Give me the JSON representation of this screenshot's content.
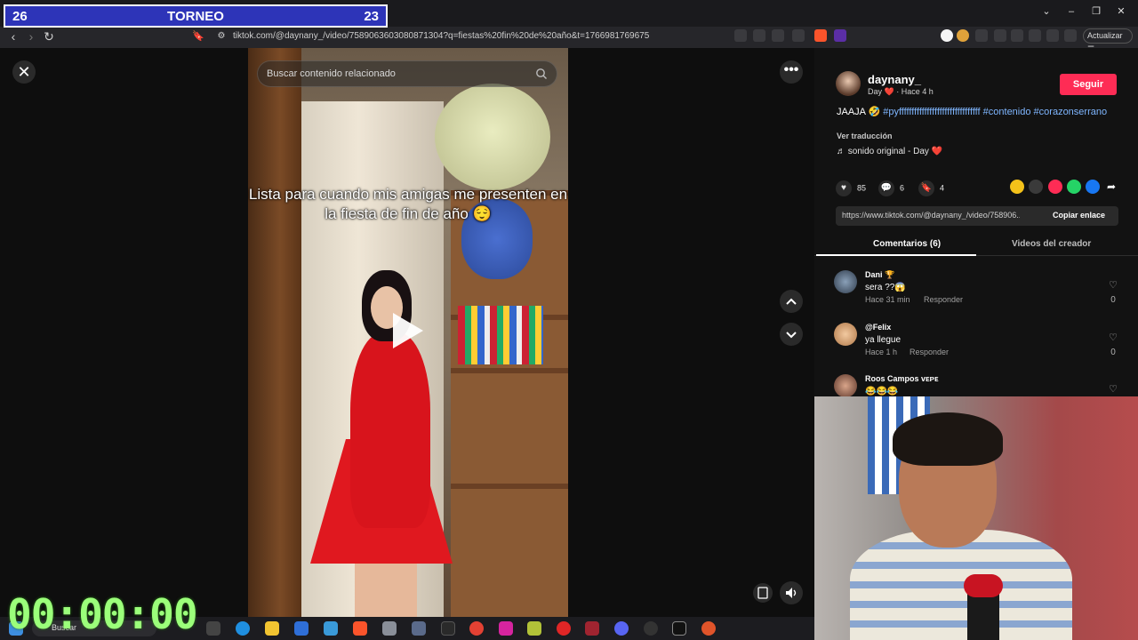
{
  "browser": {
    "url": "tiktok.com/@daynany_/video/7589063603080871304?q=fiestas%20fin%20de%20año&t=1766981769675",
    "update_label": "Actualizar"
  },
  "scoreboard": {
    "left": "26",
    "title": "TORNEO",
    "right": "23",
    "color": "#2d34b8"
  },
  "player": {
    "search_placeholder": "Buscar contenido relacionado",
    "caption": "Lista para cuando mis amigas me presenten en la fiesta de fin de año 😌"
  },
  "post": {
    "username": "daynany_",
    "subline": "Day ❤️ · Hace 4 h",
    "follow_label": "Seguir",
    "desc_prefix": "JAAJA 🤣",
    "hashtag1": "#pyffffffffffffffffffffffffffffffff",
    "hashtag2": "#contenido",
    "hashtag3": "#corazonserrano",
    "translate": "Ver traducción",
    "sound": "♬  sonido original - Day ❤️",
    "likes": "85",
    "comments": "6",
    "saves": "4",
    "link": "https://www.tiktok.com/@daynany_/video/758906...",
    "copy_label": "Copiar enlace",
    "accent": "#fe2c55"
  },
  "tabs": {
    "comments": "Comentarios (6)",
    "creator_videos": "Videos del creador"
  },
  "comments": [
    {
      "name": "Dani 🏆",
      "text": "sera ??😱",
      "time": "Hace 31 min",
      "reply": "Responder",
      "likes": "0"
    },
    {
      "name": "@Felix",
      "text": "ya llegue",
      "time": "Hace 1 h",
      "reply": "Responder",
      "likes": "0"
    },
    {
      "name": "Roos Campos ᴠᴇᴘᴇ",
      "text": "😂😂😂",
      "time": "",
      "reply": "",
      "likes": ""
    }
  ],
  "taskbar": {
    "search_label": "Buscar"
  },
  "timer": "00:00:00"
}
